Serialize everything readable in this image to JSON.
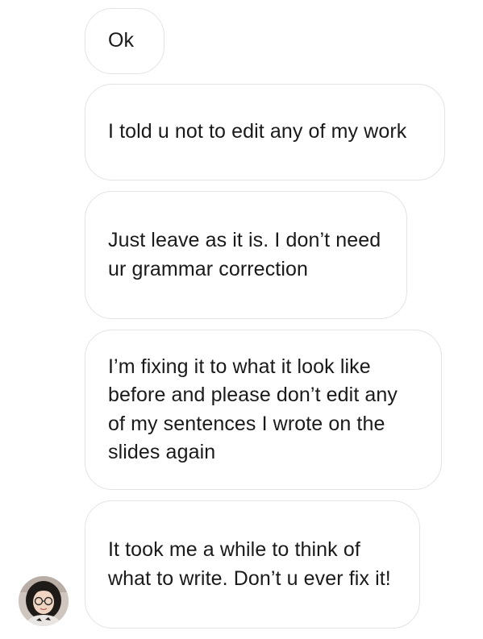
{
  "messages": [
    {
      "text": "Ok"
    },
    {
      "text": "I told u not to edit any of my work"
    },
    {
      "text": "Just leave as it is. I don’t need ur grammar correction"
    },
    {
      "text": "I’m fixing it to what it look like before and please don’t edit any of my sentences I wrote on the slides again"
    },
    {
      "text": "It took me a while to think of what to write. Don’t u ever fix it!"
    }
  ],
  "sender": {
    "avatar_icon": "profile-photo-icon"
  },
  "colors": {
    "bubble_border": "#e3e3e3",
    "text": "#1a1a1a",
    "background": "#ffffff"
  }
}
